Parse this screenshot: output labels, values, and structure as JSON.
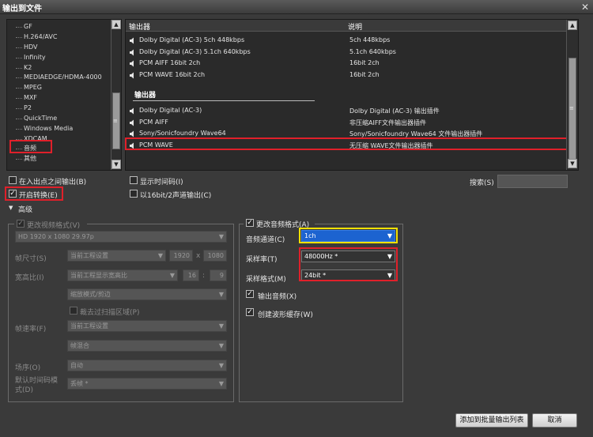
{
  "window": {
    "title": "输出到文件",
    "close_glyph": "✕"
  },
  "tree": {
    "items": [
      "GF",
      "H.264/AVC",
      "HDV",
      "Infinity",
      "K2",
      "MEDIAEDGE/HDMA-4000",
      "MPEG",
      "MXF",
      "P2",
      "QuickTime",
      "Windows Media",
      "XDCAM",
      "音频",
      "其他"
    ],
    "selected": "音频"
  },
  "list": {
    "col_exporter": "输出器",
    "col_desc": "说明",
    "top_rows": [
      {
        "name": "Dolby Digital (AC-3) 5ch 448kbps",
        "desc": "5ch 448kbps"
      },
      {
        "name": "Dolby Digital (AC-3) 5.1ch 640kbps",
        "desc": "5.1ch 640kbps"
      },
      {
        "name": "PCM AIFF 16bit 2ch",
        "desc": "16bit 2ch"
      },
      {
        "name": "PCM WAVE 16bit 2ch",
        "desc": "16bit 2ch"
      }
    ],
    "section_title": "输出器",
    "rows": [
      {
        "name": "Dolby Digital (AC-3)",
        "desc": "Dolby Digital (AC-3) 输出插件"
      },
      {
        "name": "PCM AIFF",
        "desc": "非压缩AIFF文件输出器插件"
      },
      {
        "name": "Sony/Sonicfoundry Wave64",
        "desc": "Sony/Sonicfoundry Wave64 文件输出器插件"
      },
      {
        "name": "PCM WAVE",
        "desc": "无压缩 WAVE文件输出器插件"
      }
    ]
  },
  "options": {
    "in_out_label": "在入出点之间输出(B)",
    "enable_convert_label": "开启转换(E)",
    "show_timecode_label": "显示时间码(I)",
    "output_16bit_label": "以16bit/2声道输出(C)",
    "search_label": "搜索(S)",
    "search_value": ""
  },
  "advanced": {
    "toggle_label": "高级",
    "video": {
      "change_format_label": "更改视频格式(V)",
      "format_value": "HD 1920 x 1080 29.97p",
      "frame_size_label": "帧尺寸(S)",
      "frame_size_value": "当前工程设置",
      "width": "1920",
      "x_sep": "x",
      "height": "1080",
      "aspect_label": "宽高比(I)",
      "aspect_value": "当前工程显示宽高比",
      "aspect_w": "16",
      "colon": ":",
      "aspect_h": "9",
      "stretch_value": "缩放模式/剪边",
      "crop_label": "裁去过扫描区域(P)",
      "framerate_label": "帧速率(F)",
      "framerate_value": "当前工程设置",
      "blend_value": "帧混合",
      "field_order_label": "场序(O)",
      "field_order_value": "自动",
      "timecode_mode_label": "默认时间码模式(D)",
      "timecode_mode_value": "丢帧 *"
    },
    "audio": {
      "change_format_label": "更改音频格式(A)",
      "channels_label": "音频通道(C)",
      "channels_value": "1ch",
      "samplerate_label": "采样率(T)",
      "samplerate_value": "48000Hz *",
      "sampleformat_label": "采样格式(M)",
      "sampleformat_value": "24bit *",
      "output_audio_label": "输出音频(X)",
      "waveform_cache_label": "创建波形缓存(W)"
    }
  },
  "buttons": {
    "add_batch": "添加到批量输出列表",
    "cancel": "取消"
  },
  "colors": {
    "highlight_red": "#e0202a",
    "highlight_yellow": "#f0e000",
    "select_blue": "#1c63d0"
  }
}
